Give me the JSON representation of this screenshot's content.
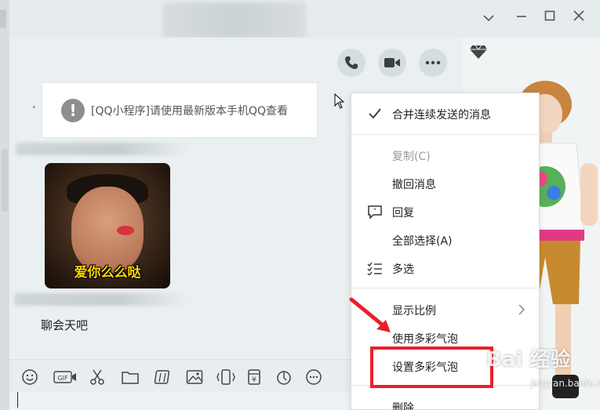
{
  "titlebar": {
    "controls": {
      "dropdown_icon": "chevron-down-icon",
      "minimize_icon": "minimize-icon",
      "maximize_icon": "maximize-icon",
      "close_icon": "close-icon"
    }
  },
  "chat": {
    "system_message": "[QQ小程序]请使用最新版本手机QQ查看",
    "sticker_caption": "爱你么么哒",
    "text_message": "聊会天吧"
  },
  "toolbar": {
    "tools": [
      "emoji-icon",
      "gif-icon",
      "scissors-icon",
      "folder-icon",
      "sticker-icon",
      "image-icon",
      "shake-icon",
      "red-packet-icon",
      "voice-icon",
      "more-icon"
    ]
  },
  "context_menu": {
    "items": [
      {
        "label": "合并连续发送的消息",
        "icon": "check-icon",
        "disabled": false
      },
      {
        "label": "复制(C)",
        "disabled": true
      },
      {
        "label": "撤回消息",
        "disabled": false
      },
      {
        "label": "回复",
        "icon": "reply-icon",
        "disabled": false
      },
      {
        "label": "全部选择(A)",
        "disabled": false
      },
      {
        "label": "多选",
        "icon": "multi-select-icon",
        "disabled": false
      },
      {
        "label": "显示比例",
        "disabled": false,
        "submenu": true
      },
      {
        "label": "使用多彩气泡",
        "disabled": false
      },
      {
        "label": "设置多彩气泡",
        "disabled": false
      },
      {
        "label": "删除",
        "disabled": false
      }
    ]
  },
  "watermark": {
    "brand": "Bai 经验",
    "url": "jingyan.baidu.com"
  },
  "colors": {
    "highlight": "#e8202a",
    "menu_bg": "#ffffff",
    "chat_bg": "#eaeff1"
  }
}
